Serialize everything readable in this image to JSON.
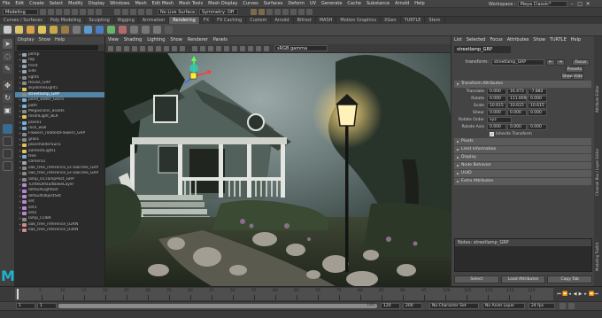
{
  "menubar": {
    "items": [
      "File",
      "Edit",
      "Create",
      "Select",
      "Modify",
      "Display",
      "Windows",
      "Mesh",
      "Edit Mesh",
      "Mesh Tools",
      "Mesh Display",
      "Curves",
      "Surfaces",
      "Deform",
      "UV",
      "Generate",
      "Cache",
      "Substance",
      "Arnold",
      "Help"
    ],
    "workspace_label": "Workspace :",
    "workspace_value": "Maya Classic*"
  },
  "statusline": {
    "mode": "Modeling",
    "live_surface": "No Live Surface",
    "symmetry": "Symmetry: Off"
  },
  "shelf_tabs": [
    "Curves / Surfaces",
    "Poly Modeling",
    "Sculpting",
    "Rigging",
    "Animation",
    "Rendering",
    "FX",
    "FX Caching",
    "Custom",
    "Arnold",
    "Bifrost",
    "MASH",
    "Motion Graphics",
    "XGen",
    "TURTLE",
    "Stem"
  ],
  "active_shelf_tab": "Rendering",
  "outliner": {
    "menu": [
      "Display",
      "Show",
      "Help"
    ],
    "items": [
      {
        "label": "persp",
        "icon": "camera-icon"
      },
      {
        "label": "top",
        "icon": "camera-icon"
      },
      {
        "label": "front",
        "icon": "camera-icon"
      },
      {
        "label": "side",
        "icon": "camera-icon"
      },
      {
        "label": "lights",
        "icon": "group-icon"
      },
      {
        "label": "House_GRP",
        "icon": "group-icon"
      },
      {
        "label": "skydomeLight1",
        "icon": "light-icon"
      },
      {
        "label": "streetlamp_GRP",
        "icon": "group-icon"
      },
      {
        "label": "pond_water_GEO1",
        "icon": "mesh-icon"
      },
      {
        "label": "path",
        "icon": "mesh-icon"
      },
      {
        "label": "Megascans_assets",
        "icon": "group-icon"
      },
      {
        "label": "meshLight_BLR",
        "icon": "light-icon"
      },
      {
        "label": "plane1",
        "icon": "mesh-icon"
      },
      {
        "label": "rock_wall",
        "icon": "mesh-icon"
      },
      {
        "label": "Flowers_related/Flowers_GRP",
        "icon": "group-icon"
      },
      {
        "label": "grass",
        "icon": "group-icon"
      },
      {
        "label": "placeholderSun1",
        "icon": "light-icon"
      },
      {
        "label": "ailmeshLight1",
        "icon": "light-icon"
      },
      {
        "label": "tree",
        "icon": "mesh-icon"
      },
      {
        "label": "camera1",
        "icon": "camera-icon"
      },
      {
        "label": "oak_tree_reference_EF:oakTree_GRP",
        "icon": "group-icon"
      },
      {
        "label": "oak_tree_reference_EF:oakTree_GRP",
        "icon": "group-icon"
      },
      {
        "label": "lamp_01:lampPost_GRP",
        "icon": "group-icon"
      },
      {
        "label": "TurtleDefaultBakeLayer",
        "icon": "set-icon"
      },
      {
        "label": "defaultLightSet",
        "icon": "set-icon"
      },
      {
        "label": "defaultObjectSet",
        "icon": "set-icon"
      },
      {
        "label": "set",
        "icon": "set-icon"
      },
      {
        "label": "set1",
        "icon": "set-icon"
      },
      {
        "label": "set2",
        "icon": "set-icon"
      },
      {
        "label": "lamp_COBR",
        "icon": "group-icon"
      },
      {
        "label": "oak_tree_reference_02RN",
        "icon": "ref-icon"
      },
      {
        "label": "oak_tree_reference_03RN",
        "icon": "ref-icon"
      }
    ],
    "selected_index": 7
  },
  "viewport": {
    "menu": [
      "View",
      "Shading",
      "Lighting",
      "Show",
      "Renderer",
      "Panels"
    ],
    "gamma": "sRGB gamma"
  },
  "attribute_editor": {
    "menu": [
      "List",
      "Selected",
      "Focus",
      "Attributes",
      "Show",
      "TURTLE",
      "Help"
    ],
    "tab": "streetlamp_GRP",
    "transform_label": "transform:",
    "transform_value": "streetlamp_GRP",
    "focus_button": "Focus",
    "presets_button": "Presets",
    "show_button": "Show",
    "hide_button": "Hide",
    "section_transform": "Transform Attributes",
    "translate_label": "Translate",
    "translate": [
      "0.000",
      "16.473",
      "-7.882"
    ],
    "rotate_label": "Rotate",
    "rotate": [
      "0.000",
      "111.669",
      "0.000"
    ],
    "scale_label": "Scale",
    "scale": [
      "10.615",
      "10.615",
      "10.615"
    ],
    "shear_label": "Shear",
    "shear": [
      "0.000",
      "0.000",
      "0.000"
    ],
    "rotate_order_label": "Rotate Order",
    "rotate_order": "xyz",
    "rotate_axis_label": "Rotate Axis",
    "rotate_axis": [
      "0.000",
      "0.000",
      "0.000"
    ],
    "inherits_label": "Inherits Transform",
    "sections": [
      "Pivots",
      "Limit Information",
      "Display",
      "Node Behavior",
      "UUID",
      "Extra Attributes"
    ],
    "notes_label": "Notes: streetlamp_GRP",
    "select_button": "Select",
    "load_attributes_button": "Load Attributes",
    "copy_tab_button": "Copy Tab"
  },
  "side_tabs": [
    "Attribute Editor",
    "Channel Box / Layer Editor",
    "Modeling Toolkit"
  ],
  "timeline": {
    "ticks": [
      "5",
      "10",
      "15",
      "20",
      "25",
      "30",
      "35",
      "40",
      "45",
      "50",
      "55",
      "60",
      "65",
      "70",
      "75",
      "80",
      "85",
      "90",
      "95",
      "100",
      "105",
      "110",
      "115",
      "120"
    ],
    "current_frame": "1"
  },
  "range": {
    "start": "1",
    "start2": "1",
    "range_label": "120",
    "end": "120",
    "end2": "200",
    "character_set": "No Character Set",
    "anim_layer": "No Anim Layer",
    "fps": "24 fps"
  },
  "colors": {
    "selection": "#5285a6",
    "maya_logo": "#1fb2c9"
  }
}
